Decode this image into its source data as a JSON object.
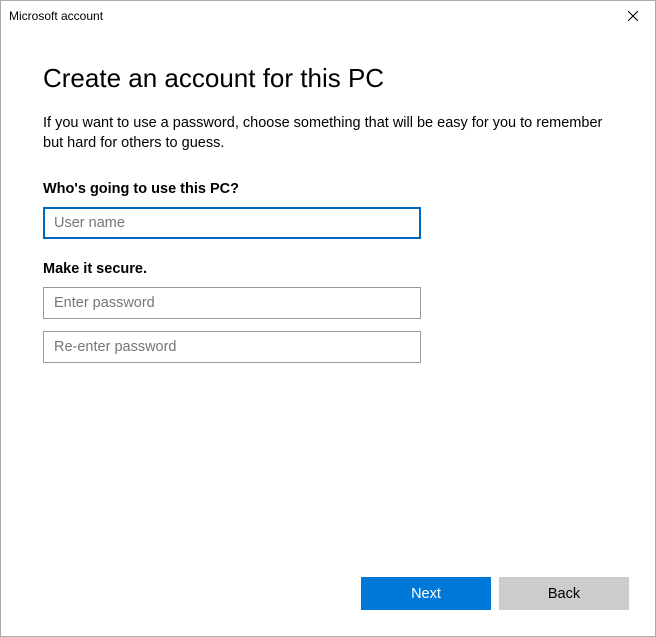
{
  "window": {
    "title": "Microsoft account"
  },
  "main": {
    "heading": "Create an account for this PC",
    "subtext": "If you want to use a password, choose something that will be easy for you to remember but hard for others to guess.",
    "section1_label": "Who's going to use this PC?",
    "username_placeholder": "User name",
    "username_value": "",
    "section2_label": "Make it secure.",
    "password_placeholder": "Enter password",
    "password_value": "",
    "confirm_placeholder": "Re-enter password",
    "confirm_value": ""
  },
  "footer": {
    "next_label": "Next",
    "back_label": "Back"
  }
}
